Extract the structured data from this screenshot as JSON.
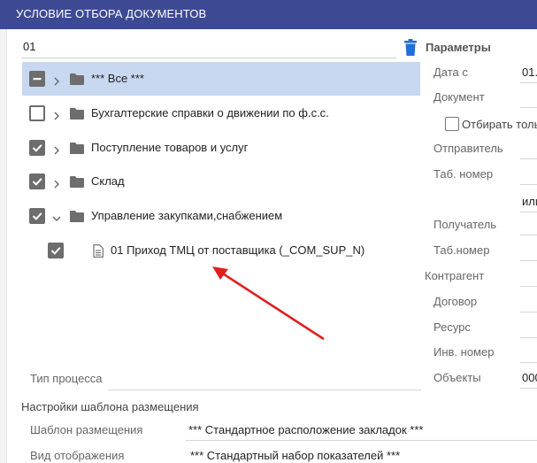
{
  "dialog": {
    "title": "УСЛОВИЕ ОТБОРА ДОКУМЕНТОВ"
  },
  "search": {
    "value": "01"
  },
  "tree": {
    "items": [
      {
        "label": "*** Все ***",
        "state": "indeterminate",
        "expand": "collapsed",
        "selected": true,
        "icon": "folder-icon"
      },
      {
        "label": "Бухгалтерские справки о движении по ф.с.с.",
        "state": "unchecked",
        "expand": "collapsed",
        "selected": false,
        "icon": "folder-icon"
      },
      {
        "label": "Поступление товаров и услуг",
        "state": "checked",
        "expand": "collapsed",
        "selected": false,
        "icon": "folder-icon"
      },
      {
        "label": "Склад",
        "state": "checked",
        "expand": "collapsed",
        "selected": false,
        "icon": "folder-icon"
      },
      {
        "label": "Управление закупками,снабжением",
        "state": "checked",
        "expand": "expanded",
        "selected": false,
        "icon": "folder-icon"
      },
      {
        "label": "01 Приход ТМЦ от поставщика (_COM_SUP_N)",
        "state": "checked",
        "expand": "none",
        "selected": false,
        "icon": "document-icon"
      }
    ]
  },
  "params": {
    "title": "Параметры",
    "date_from_label": "Дата с",
    "date_from_value": "01.",
    "document_label": "Документ",
    "select_only_label": "Отбирать толь",
    "sender_label": "Отправитель",
    "tab_number_label": "Таб. номер",
    "or_value": "или",
    "receiver_label": "Получатель",
    "tab_number2_label": "Таб.номер",
    "counterparty_label": "Контрагент",
    "contract_label": "Договор",
    "resource_label": "Ресурс",
    "inv_number_label": "Инв. номер",
    "objects_label": "Объекты",
    "objects_value": "000"
  },
  "process": {
    "label": "Тип процесса"
  },
  "placement": {
    "section_title": "Настройки шаблона размещения",
    "template_label": "Шаблон размещения",
    "template_value": "*** Стандартное расположение закладок ***",
    "view_label": "Вид отображения",
    "view_value": "*** Стандартный набор показателей ***"
  },
  "colors": {
    "titlebar": "#3d4a93",
    "selected_row": "#c7d8f0",
    "trash": "#1e6fd9",
    "arrow": "#e02020",
    "checkbox": "#6d6d6d"
  }
}
